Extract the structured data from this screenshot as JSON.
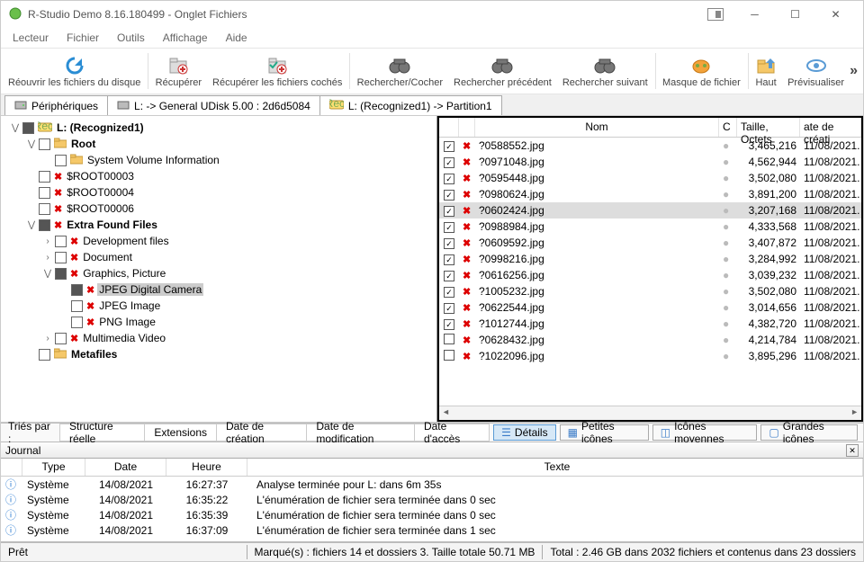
{
  "title": "R-Studio Demo 8.16.180499 - Onglet Fichiers",
  "menus": [
    "Lecteur",
    "Fichier",
    "Outils",
    "Affichage",
    "Aide"
  ],
  "toolbar": [
    {
      "id": "reopen",
      "label": "Réouvrir les fichiers du disque",
      "icon": "refresh"
    },
    {
      "id": "recover",
      "label": "Récupérer",
      "icon": "recover"
    },
    {
      "id": "recoverchk",
      "label": "Récupérer les fichiers cochés",
      "icon": "recoverchk"
    },
    {
      "id": "findmark",
      "label": "Rechercher/Cocher",
      "icon": "binoc"
    },
    {
      "id": "findprev",
      "label": "Rechercher précédent",
      "icon": "binocprev"
    },
    {
      "id": "findnext",
      "label": "Rechercher suivant",
      "icon": "binocnext"
    },
    {
      "id": "filemask",
      "label": "Masque de fichier",
      "icon": "mask"
    },
    {
      "id": "up",
      "label": "Haut",
      "icon": "up"
    },
    {
      "id": "preview",
      "label": "Prévisualiser",
      "icon": "preview"
    }
  ],
  "tabs": [
    {
      "icon": "device",
      "label": "Périphériques"
    },
    {
      "icon": "hdd",
      "label": "L: -> General UDisk 5.00 : 2d6d5084"
    },
    {
      "icon": "rec",
      "label": "L: (Recognized1) -> Partition1"
    }
  ],
  "tree": [
    {
      "d": 0,
      "tw": "-",
      "cb": "full",
      "icon": "rec",
      "label": "L: (Recognized1)",
      "bold": true
    },
    {
      "d": 1,
      "tw": "-",
      "cb": "empty",
      "icon": "folder",
      "label": "Root",
      "bold": true
    },
    {
      "d": 2,
      "tw": "",
      "cb": "empty",
      "icon": "folder",
      "label": "System Volume Information"
    },
    {
      "d": 1,
      "tw": "",
      "cb": "empty",
      "icon": "xfolder",
      "label": "$ROOT00003"
    },
    {
      "d": 1,
      "tw": "",
      "cb": "empty",
      "icon": "xfolder",
      "label": "$ROOT00004"
    },
    {
      "d": 1,
      "tw": "",
      "cb": "empty",
      "icon": "xfolder",
      "label": "$ROOT00006"
    },
    {
      "d": 1,
      "tw": "-",
      "cb": "full",
      "icon": "xfolder",
      "label": "Extra Found Files",
      "bold": true
    },
    {
      "d": 2,
      "tw": "+",
      "cb": "empty",
      "icon": "xfolder",
      "label": "Development files"
    },
    {
      "d": 2,
      "tw": "+",
      "cb": "empty",
      "icon": "xfolder",
      "label": "Document"
    },
    {
      "d": 2,
      "tw": "-",
      "cb": "full",
      "icon": "xfolder",
      "label": "Graphics, Picture"
    },
    {
      "d": 3,
      "tw": "",
      "cb": "full",
      "icon": "xfolder",
      "label": "JPEG Digital Camera",
      "sel": true
    },
    {
      "d": 3,
      "tw": "",
      "cb": "empty",
      "icon": "xfolder",
      "label": "JPEG Image"
    },
    {
      "d": 3,
      "tw": "",
      "cb": "empty",
      "icon": "xfolder",
      "label": "PNG Image"
    },
    {
      "d": 2,
      "tw": "+",
      "cb": "empty",
      "icon": "xfolder",
      "label": "Multimedia Video"
    },
    {
      "d": 1,
      "tw": "",
      "cb": "empty",
      "icon": "folder",
      "label": "Metafiles",
      "bold": true
    }
  ],
  "fileHeaders": {
    "name": "Nom",
    "c": "C",
    "size": "Taille, Octets",
    "date": "ate de créati"
  },
  "files": [
    {
      "chk": true,
      "name": "?0588552.jpg",
      "size": "3,465,216",
      "date": "11/08/2021."
    },
    {
      "chk": true,
      "name": "?0971048.jpg",
      "size": "4,562,944",
      "date": "11/08/2021."
    },
    {
      "chk": true,
      "name": "?0595448.jpg",
      "size": "3,502,080",
      "date": "11/08/2021."
    },
    {
      "chk": true,
      "name": "?0980624.jpg",
      "size": "3,891,200",
      "date": "11/08/2021."
    },
    {
      "chk": true,
      "name": "?0602424.jpg",
      "size": "3,207,168",
      "date": "11/08/2021.",
      "sel": true
    },
    {
      "chk": true,
      "name": "?0988984.jpg",
      "size": "4,333,568",
      "date": "11/08/2021."
    },
    {
      "chk": true,
      "name": "?0609592.jpg",
      "size": "3,407,872",
      "date": "11/08/2021."
    },
    {
      "chk": true,
      "name": "?0998216.jpg",
      "size": "3,284,992",
      "date": "11/08/2021."
    },
    {
      "chk": true,
      "name": "?0616256.jpg",
      "size": "3,039,232",
      "date": "11/08/2021."
    },
    {
      "chk": true,
      "name": "?1005232.jpg",
      "size": "3,502,080",
      "date": "11/08/2021."
    },
    {
      "chk": true,
      "name": "?0622544.jpg",
      "size": "3,014,656",
      "date": "11/08/2021."
    },
    {
      "chk": true,
      "name": "?1012744.jpg",
      "size": "4,382,720",
      "date": "11/08/2021."
    },
    {
      "chk": false,
      "name": "?0628432.jpg",
      "size": "4,214,784",
      "date": "11/08/2021."
    },
    {
      "chk": false,
      "name": "?1022096.jpg",
      "size": "3,895,296",
      "date": "11/08/2021."
    }
  ],
  "sort": {
    "label": "Triés par :",
    "buttons": [
      "Structure réelle",
      "Extensions",
      "Date de création",
      "Date de modification",
      "Date d'accès"
    ]
  },
  "views": [
    {
      "label": "Détails",
      "active": true
    },
    {
      "label": "Petites icônes"
    },
    {
      "label": "Icônes moyennes"
    },
    {
      "label": "Grandes icônes"
    }
  ],
  "journal": {
    "title": "Journal",
    "headers": {
      "type": "Type",
      "date": "Date",
      "time": "Heure",
      "text": "Texte"
    },
    "rows": [
      {
        "type": "Système",
        "date": "14/08/2021",
        "time": "16:27:37",
        "text": "Analyse terminée pour L: dans 6m 35s"
      },
      {
        "type": "Système",
        "date": "14/08/2021",
        "time": "16:35:22",
        "text": "L'énumération de fichier sera terminée dans 0 sec"
      },
      {
        "type": "Système",
        "date": "14/08/2021",
        "time": "16:35:39",
        "text": "L'énumération de fichier sera terminée dans 0 sec"
      },
      {
        "type": "Système",
        "date": "14/08/2021",
        "time": "16:37:09",
        "text": "L'énumération de fichier sera terminée dans 1 sec"
      }
    ]
  },
  "status": {
    "ready": "Prêt",
    "marked": "Marqué(s) : fichiers 14 et dossiers 3. Taille totale 50.71 MB",
    "total": "Total : 2.46 GB dans 2032 fichiers et contenus dans 23 dossiers"
  }
}
